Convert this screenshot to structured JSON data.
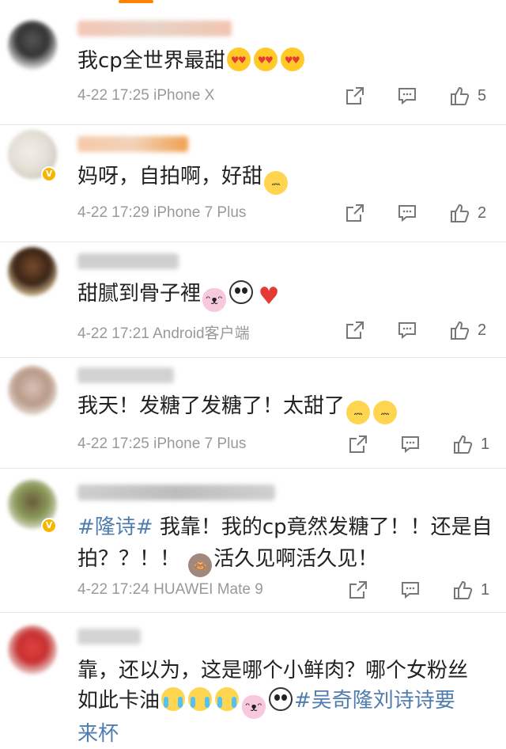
{
  "comments": [
    {
      "text": "我cp全世界最甜",
      "emojis": [
        "heart-eyes-emoji",
        "heart-eyes-emoji",
        "heart-eyes-emoji"
      ],
      "time": "4-22 17:25",
      "device": "iPhone X",
      "likes": "5"
    },
    {
      "text": "妈呀，自拍啊，好甜",
      "emojis": [
        "blush-emoji"
      ],
      "time": "4-22 17:29",
      "device": "iPhone 7 Plus",
      "likes": "2"
    },
    {
      "text": "甜腻到骨子裡",
      "emojis": [
        "pig-emoji",
        "panda-emoji",
        "red-heart-emoji"
      ],
      "time": "4-22 17:21",
      "device": "Android客户端",
      "likes": "2"
    },
    {
      "text": "我天！发糖了发糖了！太甜了",
      "emojis": [
        "blush-emoji",
        "blush-emoji"
      ],
      "time": "4-22 17:25",
      "device": "iPhone 7 Plus",
      "likes": "1"
    },
    {
      "topic": "#隆诗#",
      "text_line1": " 我靠！我的cp竟然发糖了！！还是自",
      "text_line2a": "拍？？！！",
      "text_line2b": "活久见啊活久见！",
      "time": "4-22 17:24",
      "device": "HUAWEI Mate 9",
      "likes": "1"
    },
    {
      "text_line1": "靠，还以为，这是哪个小鲜肉？哪个女粉丝",
      "text_line2": "如此卡油",
      "topic": "#吴奇隆刘诗诗要",
      "text_line3": "来杯"
    }
  ],
  "icons": {
    "share": "share-icon",
    "comment": "comment-icon",
    "like": "thumbs-up-icon"
  },
  "colors": {
    "topic": "#507daf",
    "meta": "#999999",
    "tab_indicator": "#ff8200"
  }
}
